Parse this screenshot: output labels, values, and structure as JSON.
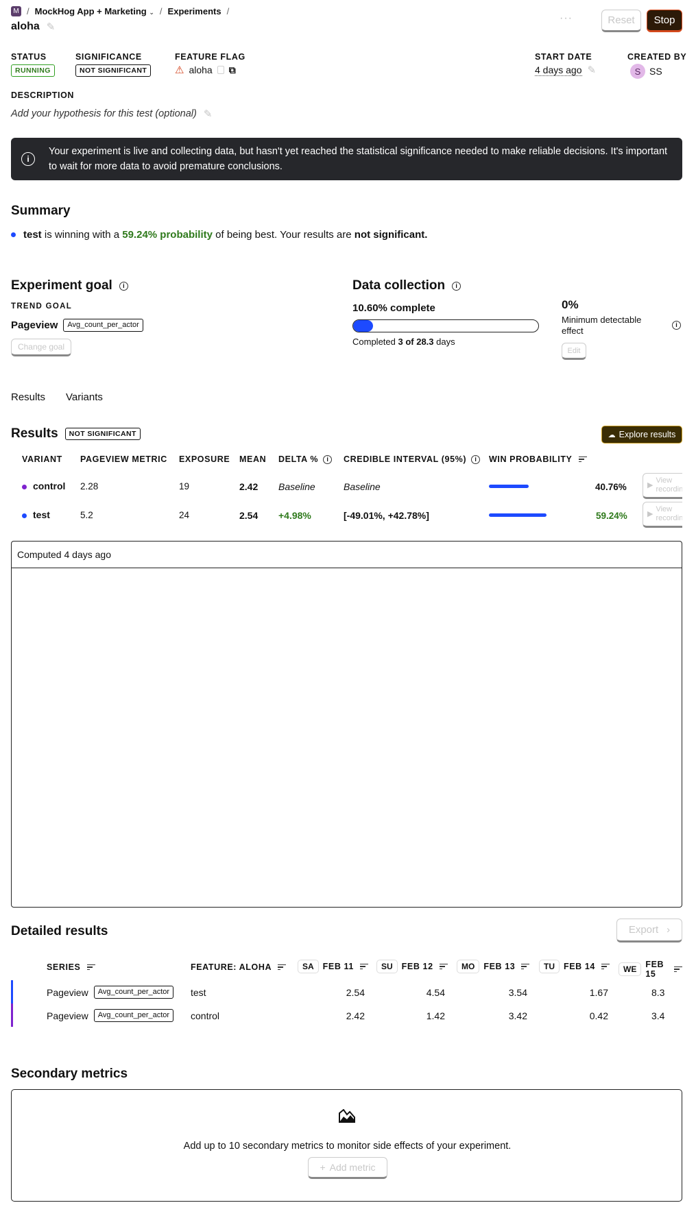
{
  "breadcrumb": {
    "org_initial": "M",
    "project": "MockHog App + Marketing",
    "section": "Experiments",
    "separator": "/"
  },
  "page": {
    "title": "aloha",
    "more": "···",
    "reset_label": "Reset",
    "stop_label": "Stop"
  },
  "meta": {
    "status_label": "STATUS",
    "status_value": "RUNNING",
    "significance_label": "SIGNIFICANCE",
    "significance_value": "NOT SIGNIFICANT",
    "flag_label": "FEATURE FLAG",
    "flag_value": "aloha",
    "start_label": "START DATE",
    "start_value": "4 days ago",
    "creator_label": "CREATED BY",
    "creator_initial": "S",
    "creator_name": "SS"
  },
  "description": {
    "label": "DESCRIPTION",
    "placeholder": "Add your hypothesis for this test (optional)"
  },
  "banner": {
    "text": "Your experiment is live and collecting data, but hasn't yet reached the statistical significance needed to make reliable decisions. It's important to wait for more data to avoid premature conclusions."
  },
  "summary": {
    "title": "Summary",
    "variant": "test",
    "text1": "is winning with a",
    "probability": "59.24% probability",
    "text2": "of being best. Your results are",
    "significance": "not significant."
  },
  "goal": {
    "title": "Experiment goal",
    "kind": "TREND GOAL",
    "event": "Pageview",
    "math": "Avg_count_per_actor",
    "change_label": "Change goal"
  },
  "collection": {
    "title": "Data collection",
    "complete": "10.60% complete",
    "progress": 10.6,
    "completed_prefix": "Completed",
    "completed_value": "3 of 28.3",
    "completed_suffix": "days",
    "mde_value": "0%",
    "mde_label": "Minimum detectable effect",
    "edit_label": "Edit"
  },
  "tabs": [
    "Results",
    "Variants"
  ],
  "results": {
    "title": "Results",
    "badge": "NOT SIGNIFICANT",
    "explore_label": "Explore results",
    "columns": [
      "VARIANT",
      "PAGEVIEW METRIC",
      "EXPOSURE",
      "MEAN",
      "DELTA %",
      "CREDIBLE INTERVAL (95%)",
      "WIN PROBABILITY"
    ],
    "rows": [
      {
        "variant": "control",
        "color": "#7e22ce",
        "metric": "2.28",
        "exposure": "19",
        "mean": "2.42",
        "delta": "Baseline",
        "interval": "Baseline",
        "win": "40.76%",
        "win_value": 40.76,
        "view": "View recordings"
      },
      {
        "variant": "test",
        "color": "#1d4aff",
        "metric": "5.2",
        "exposure": "24",
        "mean": "2.54",
        "delta": "+4.98%",
        "interval": "[-49.01%, +42.78%]",
        "win": "59.24%",
        "win_value": 59.24,
        "view": "View recordings"
      }
    ],
    "computed": "Computed 4 days ago"
  },
  "detailed": {
    "title": "Detailed results",
    "export_label": "Export",
    "col_series": "SERIES",
    "col_flag": "FEATURE: ALOHA",
    "days": [
      {
        "abbr": "SA",
        "date": "FEB 11"
      },
      {
        "abbr": "SU",
        "date": "FEB 12"
      },
      {
        "abbr": "MO",
        "date": "FEB 13"
      },
      {
        "abbr": "TU",
        "date": "FEB 14"
      },
      {
        "abbr": "WE",
        "date": "FEB 15"
      }
    ],
    "rows": [
      {
        "series": "Pageview",
        "math": "Avg_count_per_actor",
        "variant": "test",
        "color": "#1d4aff",
        "values": [
          "2.54",
          "4.54",
          "3.54",
          "1.67",
          "8.3"
        ]
      },
      {
        "series": "Pageview",
        "math": "Avg_count_per_actor",
        "variant": "control",
        "color": "#7e22ce",
        "values": [
          "2.42",
          "1.42",
          "3.42",
          "0.42",
          "3.4"
        ]
      }
    ]
  },
  "secondary": {
    "title": "Secondary metrics",
    "empty_text": "Add up to 10 secondary metrics to monitor side effects of your experiment.",
    "add_label": "Add metric"
  }
}
